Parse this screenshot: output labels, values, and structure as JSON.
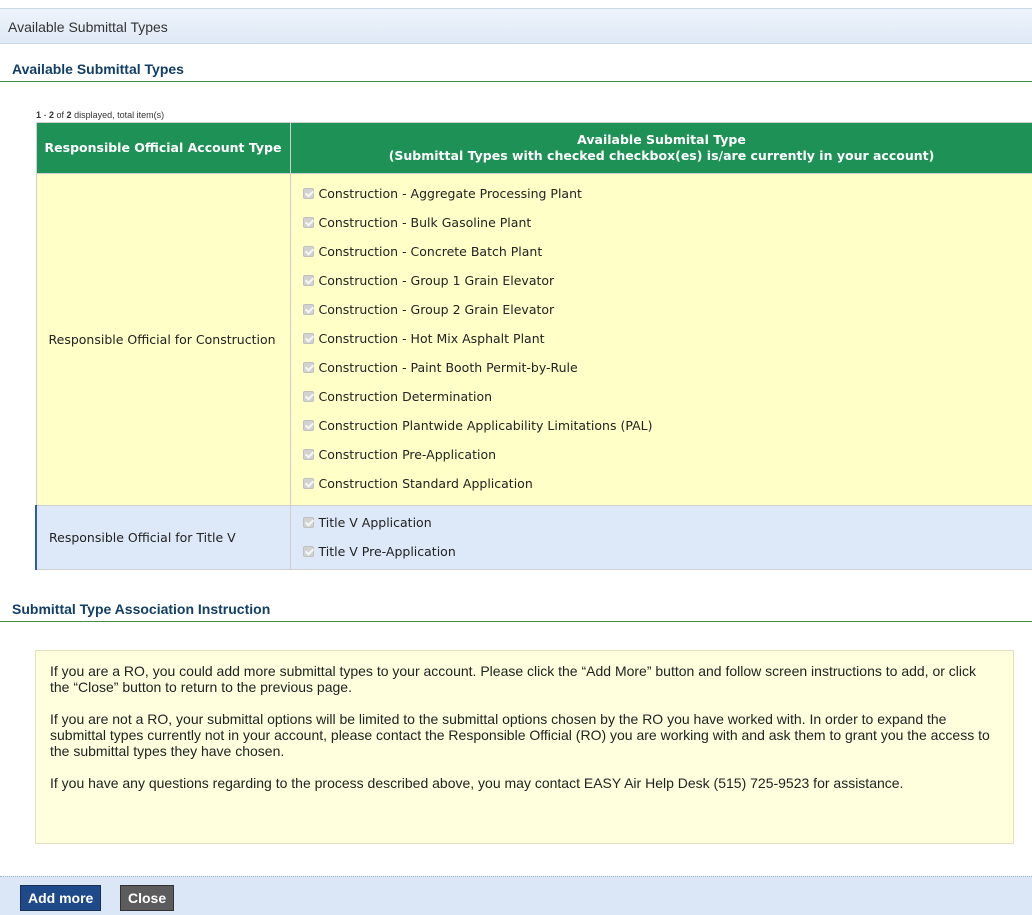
{
  "window": {
    "title": "Available Submittal Types"
  },
  "section1": {
    "title": "Available Submittal Types"
  },
  "pager": {
    "from": "1",
    "sep": " - ",
    "to": "2",
    "of_text": " of ",
    "total": "2",
    "suffix": " displayed, total item(s)"
  },
  "table": {
    "col1_header": "Responsible Official Account Type",
    "col2_header_line1": "Available Submital Type",
    "col2_header_line2": "(Submittal Types with checked checkbox(es) is/are currently in your account)",
    "rows": [
      {
        "account_type": "Responsible Official for Construction",
        "types": [
          "Construction - Aggregate Processing Plant",
          "Construction - Bulk Gasoline Plant",
          "Construction - Concrete Batch Plant",
          "Construction - Group 1 Grain Elevator",
          "Construction - Group 2 Grain Elevator",
          "Construction - Hot Mix Asphalt Plant",
          "Construction - Paint Booth Permit-by-Rule",
          "Construction Determination",
          "Construction Plantwide Applicability Limitations (PAL)",
          "Construction Pre-Application",
          "Construction Standard Application"
        ]
      },
      {
        "account_type": "Responsible Official for Title V",
        "types": [
          "Title V Application",
          "Title V Pre-Application"
        ]
      }
    ]
  },
  "section2": {
    "title": "Submittal Type Association Instruction"
  },
  "instructions": {
    "p1": "If you are a RO, you could add more submittal types to your account. Please click the “Add More” button and follow screen instructions to add, or click the “Close” button to return to the previous page.",
    "p2": "If you are not a RO, your submittal options will be limited to the submittal options chosen by the RO you have worked with. In order to expand the submittal types currently not in your account, please contact the Responsible Official (RO) you are working with and ask them to grant you the access to the submittal types they have chosen.",
    "p3": "If you have any questions regarding to the process described above, you may contact EASY Air Help Desk (515) 725-9523 for assistance."
  },
  "buttons": {
    "add_more": "Add more",
    "close": "Close"
  },
  "icons": {
    "checkbox": "checked-disabled-checkbox-icon"
  },
  "colors": {
    "header_green": "#1e9157",
    "row_yellow": "#ffffc8",
    "row_blue": "#dde9f8",
    "button_blue": "#1f4a8a",
    "button_gray": "#5c5c5c"
  }
}
